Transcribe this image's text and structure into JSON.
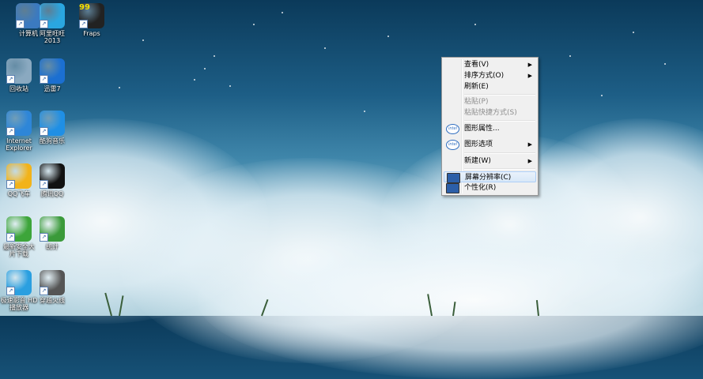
{
  "desktop_icons": [
    {
      "name": "computer",
      "label": "计算机",
      "color": "#3b7ac0"
    },
    {
      "name": "aliwangwang",
      "label": "阿里旺旺\n2013",
      "color": "#2aa6e0"
    },
    {
      "name": "fraps",
      "label": "Fraps",
      "color": "#222222",
      "badge": "99"
    },
    {
      "name": "recycle-bin",
      "label": "回收站",
      "color": "#8aa9c0"
    },
    {
      "name": "thunder",
      "label": "迅雷7",
      "color": "#1b6fd1"
    },
    {
      "name": "internet-explorer",
      "label": "Internet\nExplorer",
      "color": "#2e86d8"
    },
    {
      "name": "kugou",
      "label": "酷狗音乐",
      "color": "#1f8fe5"
    },
    {
      "name": "qq-game",
      "label": "QQ飞车",
      "color": "#f2b31a"
    },
    {
      "name": "qq",
      "label": "腾讯QQ",
      "color": "#111111"
    },
    {
      "name": "downloader",
      "label": "最新安全大\n片下载",
      "color": "#3da53a"
    },
    {
      "name": "stats",
      "label": "统计",
      "color": "#3a9a3a"
    },
    {
      "name": "video-player",
      "label": "极速影音 HD\n播放器",
      "color": "#2a9fe0"
    },
    {
      "name": "game",
      "label": "穿越火线",
      "color": "#555555"
    }
  ],
  "context_menu": {
    "items": [
      {
        "label": "查看(V)",
        "submenu": true,
        "disabled": false
      },
      {
        "label": "排序方式(O)",
        "submenu": true,
        "disabled": false
      },
      {
        "label": "刷新(E)",
        "submenu": false,
        "disabled": false
      },
      {
        "label": "粘贴(P)",
        "submenu": false,
        "disabled": true
      },
      {
        "label": "粘贴快捷方式(S)",
        "submenu": false,
        "disabled": true
      },
      {
        "label": "图形属性...",
        "submenu": false,
        "disabled": false,
        "icon": "intel"
      },
      {
        "label": "图形选项",
        "submenu": true,
        "disabled": false,
        "icon": "intel"
      },
      {
        "label": "新建(W)",
        "submenu": true,
        "disabled": false
      },
      {
        "label": "屏幕分辨率(C)",
        "submenu": false,
        "disabled": false,
        "icon": "monitor",
        "highlighted": true
      },
      {
        "label": "个性化(R)",
        "submenu": false,
        "disabled": false,
        "icon": "monitor"
      }
    ],
    "intel_text": "intel",
    "submenu_glyph": "▶"
  }
}
